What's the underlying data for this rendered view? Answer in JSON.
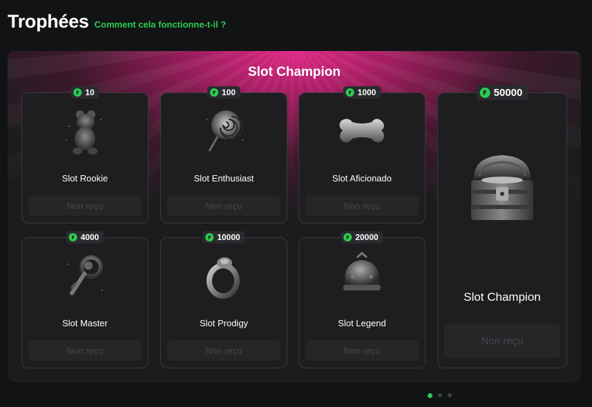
{
  "header": {
    "title": "Trophées",
    "how_link": "Comment cela fonctionne-t-il ?"
  },
  "panel": {
    "title": "Slot Champion"
  },
  "colors": {
    "accent": "#2ecc52",
    "banner": "#e8288a",
    "card_bg": "#1e1e20"
  },
  "trophies": [
    {
      "name": "Slot Rookie",
      "points": "10",
      "status": "Non reçu",
      "icon": "teddy-bear-icon"
    },
    {
      "name": "Slot Enthusiast",
      "points": "100",
      "status": "Non reçu",
      "icon": "lollipop-icon"
    },
    {
      "name": "Slot Aficionado",
      "points": "1000",
      "status": "Non reçu",
      "icon": "bone-icon"
    },
    {
      "name": "Slot Master",
      "points": "4000",
      "status": "Non reçu",
      "icon": "key-icon"
    },
    {
      "name": "Slot Prodigy",
      "points": "10000",
      "status": "Non reçu",
      "icon": "ring-icon"
    },
    {
      "name": "Slot Legend",
      "points": "20000",
      "status": "Non reçu",
      "icon": "helmet-icon"
    },
    {
      "name": "Slot Champion",
      "points": "50000",
      "status": "Non reçu",
      "icon": "treasure-chest-icon"
    }
  ],
  "pagination": {
    "current": 1,
    "total": 3
  }
}
